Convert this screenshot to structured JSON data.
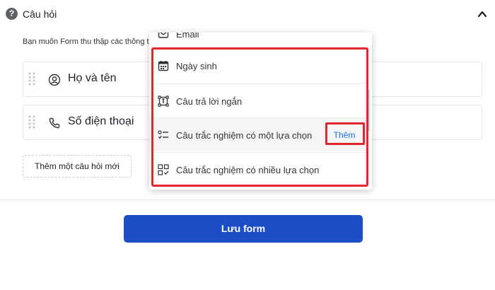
{
  "section": {
    "title": "Câu hỏi",
    "description": "Bạn muốn Form thu thập các thông t"
  },
  "fields": [
    {
      "label": "Họ và tên",
      "icon": "user-circle-icon"
    },
    {
      "label": "Số điện thoại",
      "icon": "phone-icon"
    }
  ],
  "add_question_label": "Thêm một câu hỏi mới",
  "save_label": "Lưu form",
  "dropdown": {
    "partial_item": {
      "label": "Email",
      "icon": "mail-icon"
    },
    "items": [
      {
        "label": "Ngày sinh",
        "icon": "calendar-icon"
      },
      {
        "label": "Câu trả lời ngắn",
        "icon": "text-cursor-icon"
      },
      {
        "label": "Câu trắc nghiệm có một lựa chọn",
        "icon": "single-choice-icon",
        "action": "Thêm"
      },
      {
        "label": "Câu trắc nghiệm có nhiều lựa chọn",
        "icon": "multi-choice-icon"
      }
    ]
  },
  "colors": {
    "primary": "#1d4fc4",
    "link": "#1a73e8",
    "highlight": "#e3262e"
  }
}
